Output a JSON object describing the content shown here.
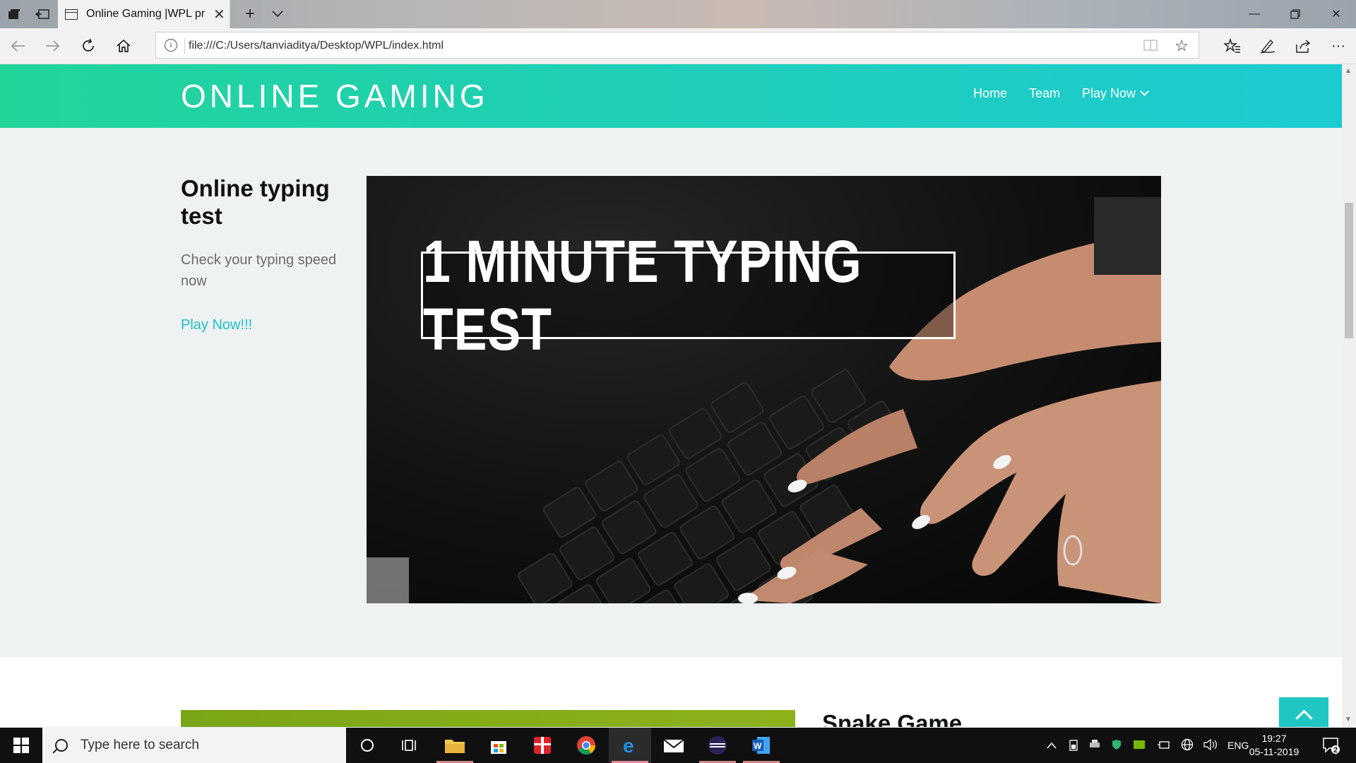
{
  "browser": {
    "tab_title": "Online Gaming |WPL pr",
    "url": "file:///C:/Users/tanviaditya/Desktop/WPL/index.html"
  },
  "site": {
    "logo": "ONLINE GAMING",
    "nav": {
      "home": "Home",
      "team": "Team",
      "play_now": "Play Now"
    }
  },
  "hero": {
    "title": "Online typing test",
    "subtitle": "Check your typing speed now",
    "link": "Play Now!!!",
    "image_banner": "1 MINUTE TYPING TEST"
  },
  "next_section": {
    "title": "Snake Game"
  },
  "taskbar": {
    "search_placeholder": "Type here to search",
    "language": "ENG",
    "time": "19:27",
    "date": "05-11-2019",
    "notification_count": "2"
  },
  "colors": {
    "header_gradient_start": "#22d49a",
    "header_gradient_end": "#1ccbd1",
    "accent": "#1fc0c8",
    "green_block": "#8cb21a"
  },
  "icons": [
    "back-icon",
    "forward-icon",
    "refresh-icon",
    "home-icon",
    "info-icon",
    "reading-view-icon",
    "favorite-star-icon",
    "favorites-icon",
    "pen-icon",
    "share-icon",
    "more-icon",
    "chevron-down-icon",
    "arrow-up-icon",
    "windows-icon",
    "search-icon",
    "cortana-icon",
    "task-view-icon",
    "file-explorer-icon",
    "store-icon",
    "gift-icon",
    "chrome-icon",
    "edge-icon",
    "mail-icon",
    "eclipse-icon",
    "word-icon",
    "notification-icon"
  ]
}
